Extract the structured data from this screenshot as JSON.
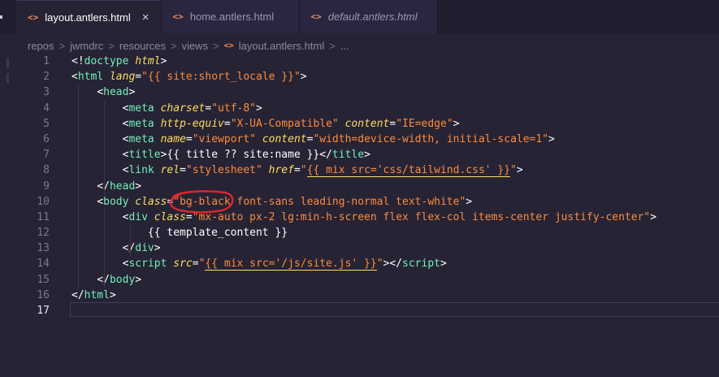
{
  "tabs": [
    {
      "label": "layout.antlers.html",
      "icon": "html-file-icon",
      "active": true,
      "italic": false,
      "close": "×"
    },
    {
      "label": "home.antlers.html",
      "icon": "html-file-icon",
      "active": false,
      "italic": false
    },
    {
      "label": "default.antlers.html",
      "icon": "html-file-icon",
      "active": false,
      "italic": true
    }
  ],
  "file_icon_glyph": "<>",
  "breadcrumb": [
    "repos",
    "jwmdrc",
    "resources",
    "views",
    "layout.antlers.html",
    "..."
  ],
  "breadcrumb_sep": ">",
  "lines": [
    {
      "n": "1",
      "tokens": [
        [
          "punc",
          "<!"
        ],
        [
          "tag",
          "doctype "
        ],
        [
          "attr",
          "html"
        ],
        [
          "punc",
          ">"
        ]
      ]
    },
    {
      "n": "2",
      "tokens": [
        [
          "punc",
          "<"
        ],
        [
          "tag",
          "html "
        ],
        [
          "attr",
          "lang"
        ],
        [
          "punc",
          "="
        ],
        [
          "str",
          "\"{{ site:short_locale }}\""
        ],
        [
          "punc",
          ">"
        ]
      ]
    },
    {
      "n": "3",
      "tokens": [
        [
          "plain",
          "    "
        ],
        [
          "punc",
          "<"
        ],
        [
          "tag",
          "head"
        ],
        [
          "punc",
          ">"
        ]
      ]
    },
    {
      "n": "4",
      "tokens": [
        [
          "plain",
          "        "
        ],
        [
          "punc",
          "<"
        ],
        [
          "tag",
          "meta "
        ],
        [
          "attr",
          "charset"
        ],
        [
          "punc",
          "="
        ],
        [
          "str",
          "\"utf-8\""
        ],
        [
          "punc",
          ">"
        ]
      ]
    },
    {
      "n": "5",
      "tokens": [
        [
          "plain",
          "        "
        ],
        [
          "punc",
          "<"
        ],
        [
          "tag",
          "meta "
        ],
        [
          "attr",
          "http-equiv"
        ],
        [
          "punc",
          "="
        ],
        [
          "str",
          "\"X-UA-Compatible\" "
        ],
        [
          "attr",
          "content"
        ],
        [
          "punc",
          "="
        ],
        [
          "str",
          "\"IE=edge\""
        ],
        [
          "punc",
          ">"
        ]
      ]
    },
    {
      "n": "6",
      "tokens": [
        [
          "plain",
          "        "
        ],
        [
          "punc",
          "<"
        ],
        [
          "tag",
          "meta "
        ],
        [
          "attr",
          "name"
        ],
        [
          "punc",
          "="
        ],
        [
          "str",
          "\"viewport\" "
        ],
        [
          "attr",
          "content"
        ],
        [
          "punc",
          "="
        ],
        [
          "str",
          "\"width=device-width, initial-scale=1\""
        ],
        [
          "punc",
          ">"
        ]
      ]
    },
    {
      "n": "7",
      "tokens": [
        [
          "plain",
          "        "
        ],
        [
          "punc",
          "<"
        ],
        [
          "tag",
          "title"
        ],
        [
          "punc",
          ">"
        ],
        [
          "plain",
          "{{ title ?? site:name }}"
        ],
        [
          "punc",
          "</"
        ],
        [
          "tag",
          "title"
        ],
        [
          "punc",
          ">"
        ]
      ]
    },
    {
      "n": "8",
      "tokens": [
        [
          "plain",
          "        "
        ],
        [
          "punc",
          "<"
        ],
        [
          "tag",
          "link "
        ],
        [
          "attr",
          "rel"
        ],
        [
          "punc",
          "="
        ],
        [
          "str",
          "\"stylesheet\" "
        ],
        [
          "attr",
          "href"
        ],
        [
          "punc",
          "="
        ],
        [
          "str",
          "\""
        ],
        [
          "stru",
          "{{ mix src='css/tailwind.css' }}"
        ],
        [
          "str",
          "\""
        ],
        [
          "punc",
          ">"
        ]
      ]
    },
    {
      "n": "9",
      "tokens": [
        [
          "plain",
          "    "
        ],
        [
          "punc",
          "</"
        ],
        [
          "tag",
          "head"
        ],
        [
          "punc",
          ">"
        ]
      ]
    },
    {
      "n": "10",
      "tokens": [
        [
          "plain",
          "    "
        ],
        [
          "punc",
          "<"
        ],
        [
          "tag",
          "body "
        ],
        [
          "attr",
          "class"
        ],
        [
          "punc",
          "="
        ],
        [
          "str",
          "\"bg-black font-sans leading-normal text-white\""
        ],
        [
          "punc",
          ">"
        ]
      ]
    },
    {
      "n": "11",
      "tokens": [
        [
          "plain",
          "        "
        ],
        [
          "punc",
          "<"
        ],
        [
          "tag",
          "div "
        ],
        [
          "attr",
          "class"
        ],
        [
          "punc",
          "="
        ],
        [
          "str",
          "\"mx-auto px-2 lg:min-h-screen flex flex-col items-center justify-center\""
        ],
        [
          "punc",
          ">"
        ]
      ]
    },
    {
      "n": "12",
      "tokens": [
        [
          "plain",
          "            {{ template_content }}"
        ]
      ]
    },
    {
      "n": "13",
      "tokens": [
        [
          "plain",
          "        "
        ],
        [
          "punc",
          "</"
        ],
        [
          "tag",
          "div"
        ],
        [
          "punc",
          ">"
        ]
      ]
    },
    {
      "n": "14",
      "tokens": [
        [
          "plain",
          "        "
        ],
        [
          "punc",
          "<"
        ],
        [
          "tag",
          "script "
        ],
        [
          "attr",
          "src"
        ],
        [
          "punc",
          "="
        ],
        [
          "str",
          "\""
        ],
        [
          "stru",
          "{{ mix src='/js/site.js' }}"
        ],
        [
          "str",
          "\""
        ],
        [
          "punc",
          "></"
        ],
        [
          "tag",
          "script"
        ],
        [
          "punc",
          ">"
        ]
      ]
    },
    {
      "n": "15",
      "tokens": [
        [
          "plain",
          "    "
        ],
        [
          "punc",
          "</"
        ],
        [
          "tag",
          "body"
        ],
        [
          "punc",
          ">"
        ]
      ]
    },
    {
      "n": "16",
      "tokens": [
        [
          "punc",
          "</"
        ],
        [
          "tag",
          "html"
        ],
        [
          "punc",
          ">"
        ]
      ]
    },
    {
      "n": "17",
      "tokens": []
    }
  ],
  "active_line": "17",
  "colors": {
    "tag": "#72f1b8",
    "attr": "#fede5d",
    "string": "#ff8b39",
    "annotation": "#e0262b",
    "background": "#262335"
  }
}
